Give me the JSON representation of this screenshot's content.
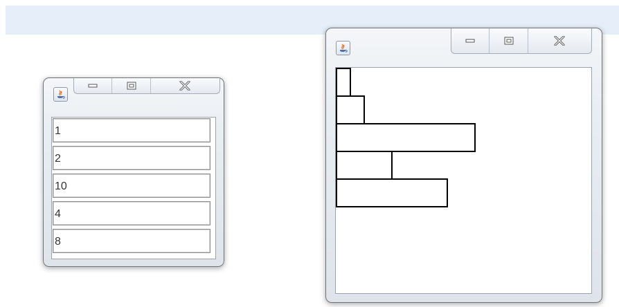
{
  "left_window": {
    "fields": [
      {
        "value": "1"
      },
      {
        "value": "2"
      },
      {
        "value": "10"
      },
      {
        "value": "4"
      },
      {
        "value": "8"
      }
    ]
  },
  "right_window": {
    "bars": [
      1,
      2,
      10,
      4,
      8
    ]
  },
  "icons": {
    "app": "java-coffee-cup-icon",
    "minimize": "minimize-icon",
    "maximize": "maximize-icon",
    "close": "close-icon"
  }
}
